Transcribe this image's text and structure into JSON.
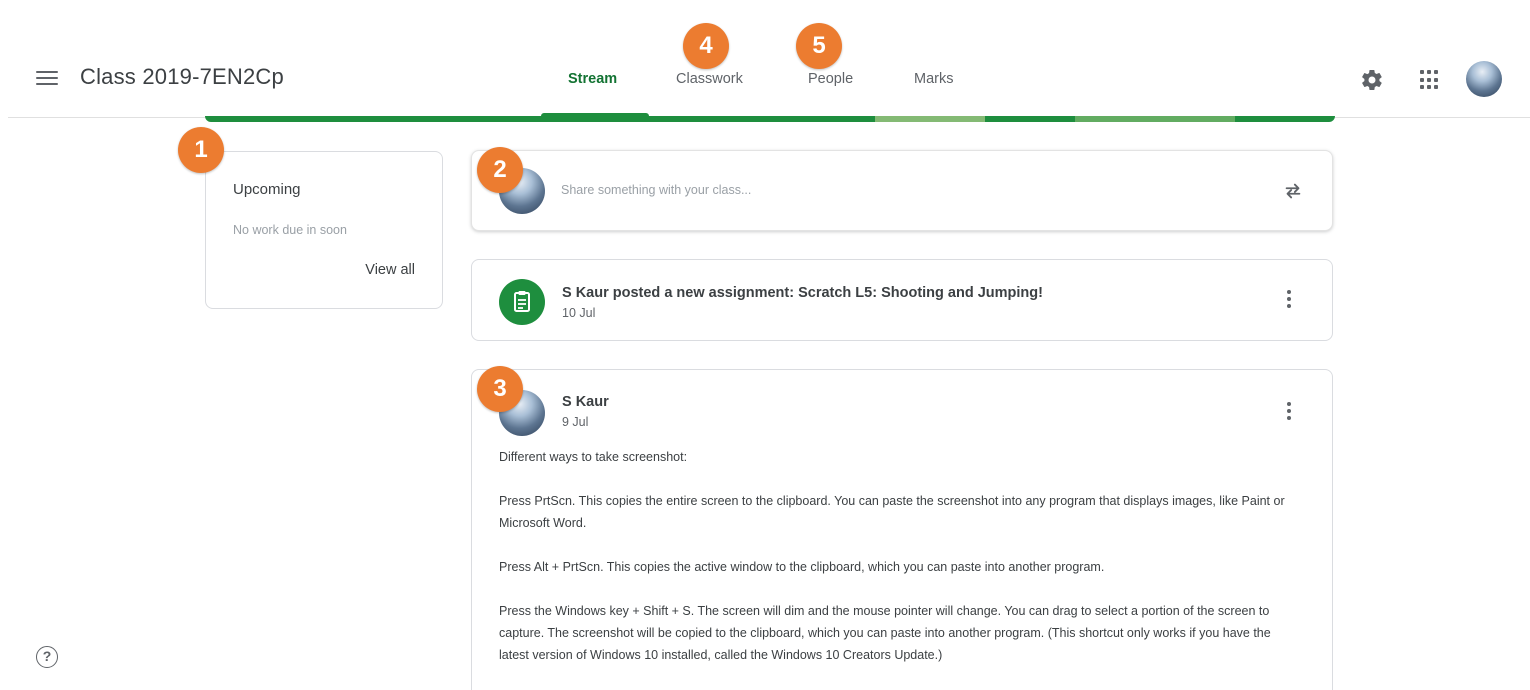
{
  "header": {
    "class_title": "Class 2019-7EN2Cp",
    "tabs": [
      {
        "label": "Stream",
        "active": true
      },
      {
        "label": "Classwork",
        "active": false
      },
      {
        "label": "People",
        "active": false
      },
      {
        "label": "Marks",
        "active": false
      }
    ],
    "icons": [
      "menu-icon",
      "settings-gear-icon",
      "apps-grid-icon",
      "account-avatar"
    ],
    "accent_color": "#1e8e3e"
  },
  "badges": {
    "b1": "1",
    "b2": "2",
    "b3": "3",
    "b4": "4",
    "b5": "5",
    "color": "#ec7c30"
  },
  "upcoming": {
    "title": "Upcoming",
    "empty_text": "No work due in soon",
    "view_all": "View all"
  },
  "share": {
    "placeholder": "Share something with your class..."
  },
  "assignment_post": {
    "title": "S Kaur posted a new assignment: Scratch L5: Shooting and Jumping!",
    "date": "10 Jul"
  },
  "announcement": {
    "author": "S Kaur",
    "date": "9 Jul",
    "paragraphs": [
      "Different ways to take screenshot:",
      "Press PrtScn. This copies the entire screen to the clipboard. You can paste the screenshot into any program that displays images, like Paint or Microsoft Word.",
      "Press Alt + PrtScn. This copies the active window to the clipboard, which you can paste into another program.",
      "Press the Windows key + Shift + S. The screen will dim and the mouse pointer will change. You can drag to select a portion of the screen to capture. The screenshot will be copied to the clipboard, which you can paste into another program. (This shortcut only works if you have the latest version of Windows 10 installed, called the Windows 10 Creators Update.)"
    ]
  },
  "help": {
    "glyph": "?"
  }
}
